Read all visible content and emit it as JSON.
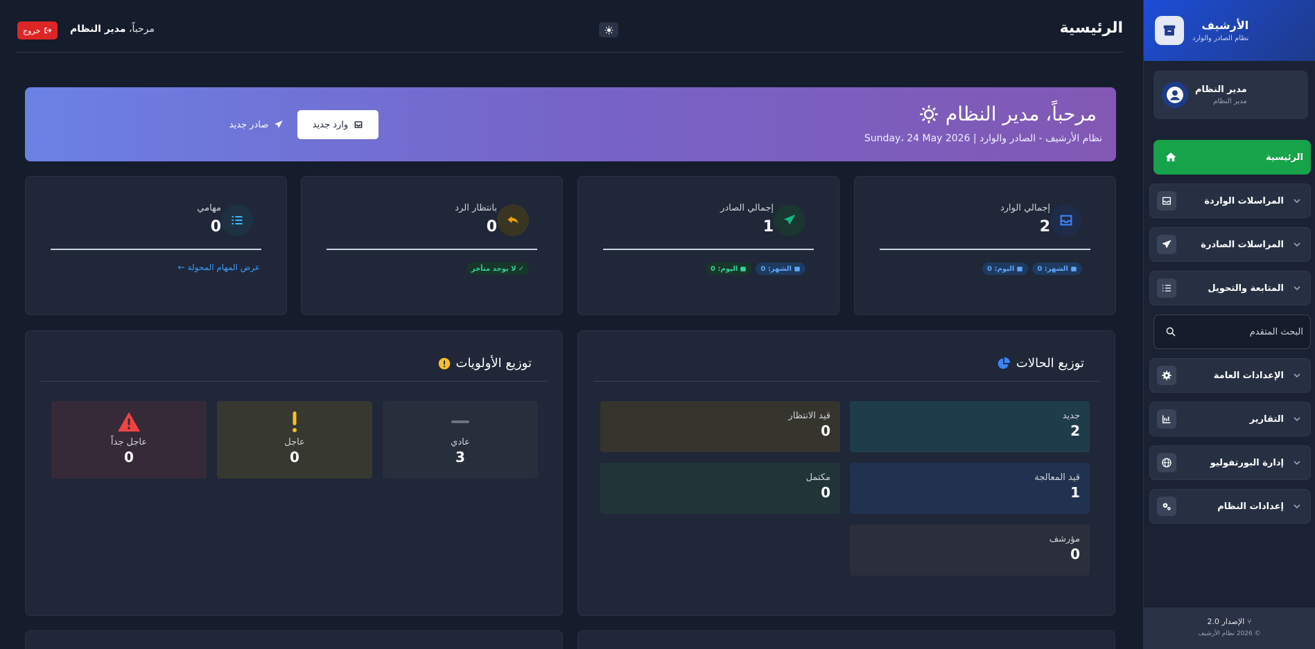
{
  "sidebar": {
    "app_title": "الأرشيف",
    "app_subtitle": "نظام الصادر والوارد",
    "user_name": "مدير النظام",
    "user_role": "مدير النظام",
    "items": [
      {
        "label": "الرئيسية",
        "icon": "home-icon"
      },
      {
        "label": "المراسلات الواردة",
        "icon": "inbox-icon"
      },
      {
        "label": "المراسلات الصادرة",
        "icon": "paper-plane-icon"
      },
      {
        "label": "المتابعة والتحويل",
        "icon": "tasks-icon"
      },
      {
        "label": "البحث المتقدم",
        "icon": "search-icon"
      },
      {
        "label": "الإعدادات العامة",
        "icon": "gear-icon"
      },
      {
        "label": "التقارير",
        "icon": "chart-icon"
      },
      {
        "label": "إدارة البورتفوليو",
        "icon": "globe-icon"
      },
      {
        "label": "إعدادات النظام",
        "icon": "gears-icon"
      }
    ],
    "version": "الإصدار 2.0",
    "copyright": "© 2026 نظام الأرشيف"
  },
  "topbar": {
    "title": "الرئيسية",
    "greeting_prefix": "مرحباً،",
    "greeting_name": "مدير النظام",
    "logout_label": "خروج"
  },
  "banner": {
    "title": "مرحباً، مدير النظام",
    "subtitle": "نظام الأرشيف - الصادر والوارد | Sunday، 24 May 2026",
    "new_incoming": "وارد جديد",
    "new_outgoing": "صادر جديد"
  },
  "stats": {
    "incoming": {
      "label": "إجمالي الوارد",
      "value": "2",
      "today": "اليوم: 0",
      "month": "الشهر: 0"
    },
    "outgoing": {
      "label": "إجمالي الصادر",
      "value": "1",
      "today": "اليوم: 0",
      "month": "الشهر: 0"
    },
    "pending": {
      "label": "بانتظار الرد",
      "value": "0",
      "badge": "لا يوجد متأخر"
    },
    "tasks": {
      "label": "مهامي",
      "value": "0",
      "link": "عرض المهام المحولة"
    }
  },
  "status_dist": {
    "title": "توزيع الحالات",
    "items": [
      {
        "label": "جديد",
        "value": "2"
      },
      {
        "label": "قيد الانتظار",
        "value": "0"
      },
      {
        "label": "قيد المعالجة",
        "value": "1"
      },
      {
        "label": "مكتمل",
        "value": "0"
      },
      {
        "label": "مؤرشف",
        "value": "0"
      }
    ]
  },
  "priority_dist": {
    "title": "توزيع الأولويات",
    "items": [
      {
        "label": "عادي",
        "value": "3"
      },
      {
        "label": "عاجل",
        "value": "0"
      },
      {
        "label": "عاجل جداً",
        "value": "0"
      }
    ]
  },
  "colors": {
    "background": "#151c2c",
    "sidebar_header": "#1d4ed8",
    "active_nav": "#16a34a",
    "logout": "#dc2626",
    "banner_start": "#6b81e4",
    "banner_end": "#8258b4"
  }
}
